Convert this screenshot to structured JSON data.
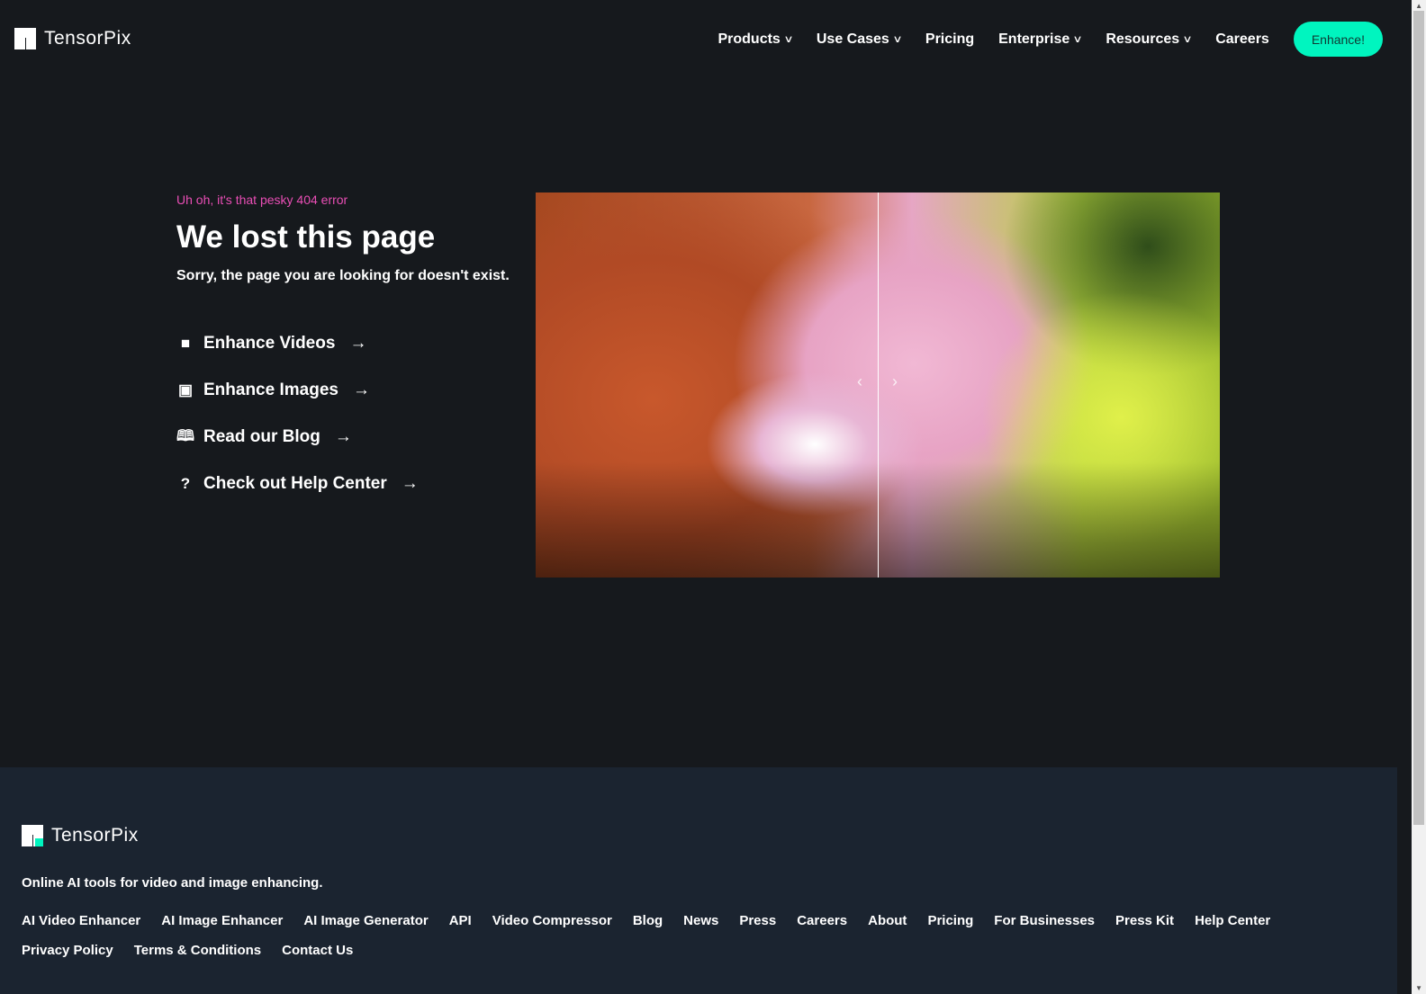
{
  "brand": {
    "name": "TensorPix",
    "accent": "#00f5bf",
    "kicker_color": "#e94eb5"
  },
  "nav": {
    "items": [
      {
        "label": "Products",
        "dropdown": true
      },
      {
        "label": "Use Cases",
        "dropdown": true
      },
      {
        "label": "Pricing",
        "dropdown": false
      },
      {
        "label": "Enterprise",
        "dropdown": true
      },
      {
        "label": "Resources",
        "dropdown": true
      },
      {
        "label": "Careers",
        "dropdown": false
      }
    ],
    "cta": "Enhance!"
  },
  "hero": {
    "kicker": "Uh oh, it's that pesky 404 error",
    "title": "We lost this page",
    "subtitle": "Sorry, the page you are looking for doesn't exist.",
    "links": [
      {
        "label": "Enhance Videos",
        "icon": "video-camera-icon"
      },
      {
        "label": "Enhance Images",
        "icon": "images-icon"
      },
      {
        "label": "Read our Blog",
        "icon": "book-icon"
      },
      {
        "label": "Check out Help Center",
        "icon": "question-icon"
      }
    ]
  },
  "footer": {
    "tagline": "Online AI tools for video and image enhancing.",
    "links": [
      "AI Video Enhancer",
      "AI Image Enhancer",
      "AI Image Generator",
      "API",
      "Video Compressor",
      "Blog",
      "News",
      "Press",
      "Careers",
      "About",
      "Pricing",
      "For Businesses",
      "Press Kit",
      "Help Center",
      "Privacy Policy",
      "Terms & Conditions",
      "Contact Us"
    ]
  }
}
